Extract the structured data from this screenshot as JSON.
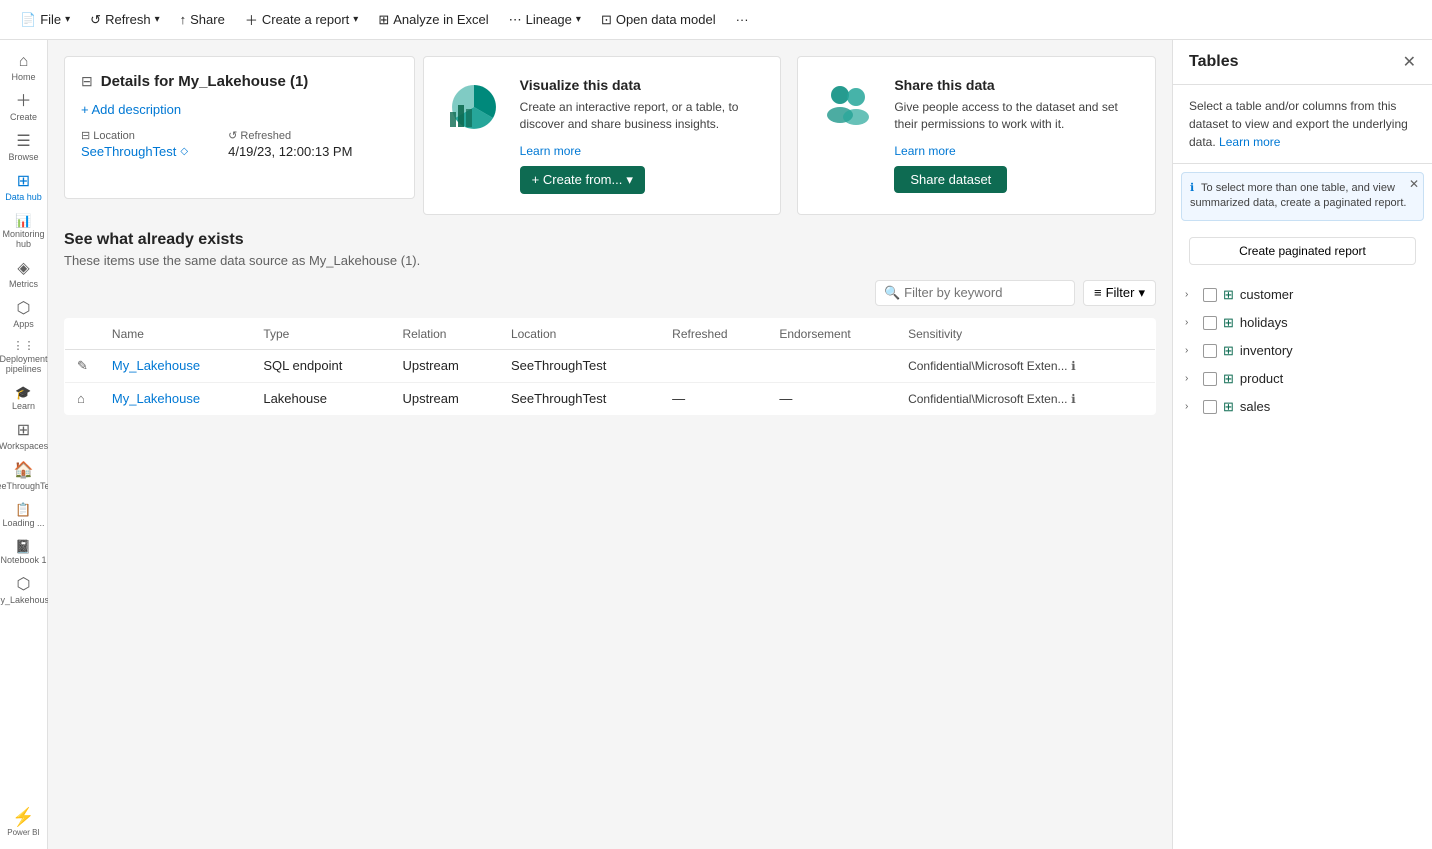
{
  "toolbar": {
    "file_label": "File",
    "refresh_label": "Refresh",
    "share_label": "Share",
    "create_report_label": "Create a report",
    "analyze_excel_label": "Analyze in Excel",
    "lineage_label": "Lineage",
    "open_data_model_label": "Open data model",
    "more_label": "···"
  },
  "sidebar": {
    "items": [
      {
        "id": "home",
        "label": "Home",
        "icon": "⌂"
      },
      {
        "id": "create",
        "label": "Create",
        "icon": "+"
      },
      {
        "id": "browse",
        "label": "Browse",
        "icon": "☰"
      },
      {
        "id": "datahub",
        "label": "Data hub",
        "icon": "⊞",
        "active": true
      },
      {
        "id": "monitoring",
        "label": "Monitoring hub",
        "icon": "📊"
      },
      {
        "id": "metrics",
        "label": "Metrics",
        "icon": "◈"
      },
      {
        "id": "apps",
        "label": "Apps",
        "icon": "⬡"
      },
      {
        "id": "deployment",
        "label": "Deployment pipelines",
        "icon": "⋮⋮"
      },
      {
        "id": "learn",
        "label": "Learn",
        "icon": "🎓"
      },
      {
        "id": "workspaces",
        "label": "Workspaces",
        "icon": "⊞"
      },
      {
        "id": "seethrough",
        "label": "SeeThroughTest",
        "icon": "🏠"
      },
      {
        "id": "loading",
        "label": "Loading ...",
        "icon": "📋"
      },
      {
        "id": "notebook",
        "label": "Notebook 1",
        "icon": "📓"
      },
      {
        "id": "mylakehouse",
        "label": "My_Lakehouse",
        "icon": "⬡"
      }
    ]
  },
  "details": {
    "title": "Details for My_Lakehouse (1)",
    "add_description": "+ Add description",
    "location_label": "Location",
    "location_value": "SeeThroughTest",
    "refreshed_label": "Refreshed",
    "refreshed_value": "4/19/23, 12:00:13 PM"
  },
  "visualize_card": {
    "title": "Visualize this data",
    "description": "Create an interactive report, or a table, to discover and share business insights.",
    "learn_more": "Learn more",
    "btn_label": "+ Create from...",
    "btn_chevron": "▾"
  },
  "share_card": {
    "title": "Share this data",
    "description": "Give people access to the dataset and set their permissions to work with it.",
    "learn_more": "Learn more",
    "btn_label": "Share dataset"
  },
  "existing": {
    "title": "See what already exists",
    "subtitle": "These items use the same data source as My_Lakehouse (1).",
    "filter_placeholder": "Filter by keyword",
    "filter_label": "Filter",
    "columns": {
      "name": "Name",
      "type": "Type",
      "relation": "Relation",
      "location": "Location",
      "refreshed": "Refreshed",
      "endorsement": "Endorsement",
      "sensitivity": "Sensitivity"
    },
    "rows": [
      {
        "icon": "✎",
        "name": "My_Lakehouse",
        "type": "SQL endpoint",
        "relation": "Upstream",
        "location": "SeeThroughTest",
        "refreshed": "",
        "endorsement": "",
        "sensitivity": "Confidential\\Microsoft Exten...",
        "row_type": "sql"
      },
      {
        "icon": "⌂",
        "name": "My_Lakehouse",
        "type": "Lakehouse",
        "relation": "Upstream",
        "location": "SeeThroughTest",
        "refreshed": "—",
        "endorsement": "—",
        "sensitivity": "Confidential\\Microsoft Exten...",
        "row_type": "lakehouse"
      }
    ]
  },
  "tables_panel": {
    "title": "Tables",
    "description": "Select a table and/or columns from this dataset to view and export the underlying data.",
    "learn_more": "Learn more",
    "notice": "To select more than one table, and view summarized data, create a paginated report.",
    "paginated_btn": "Create paginated report",
    "tables": [
      {
        "name": "customer"
      },
      {
        "name": "holidays"
      },
      {
        "name": "inventory"
      },
      {
        "name": "product"
      },
      {
        "name": "sales"
      }
    ]
  }
}
